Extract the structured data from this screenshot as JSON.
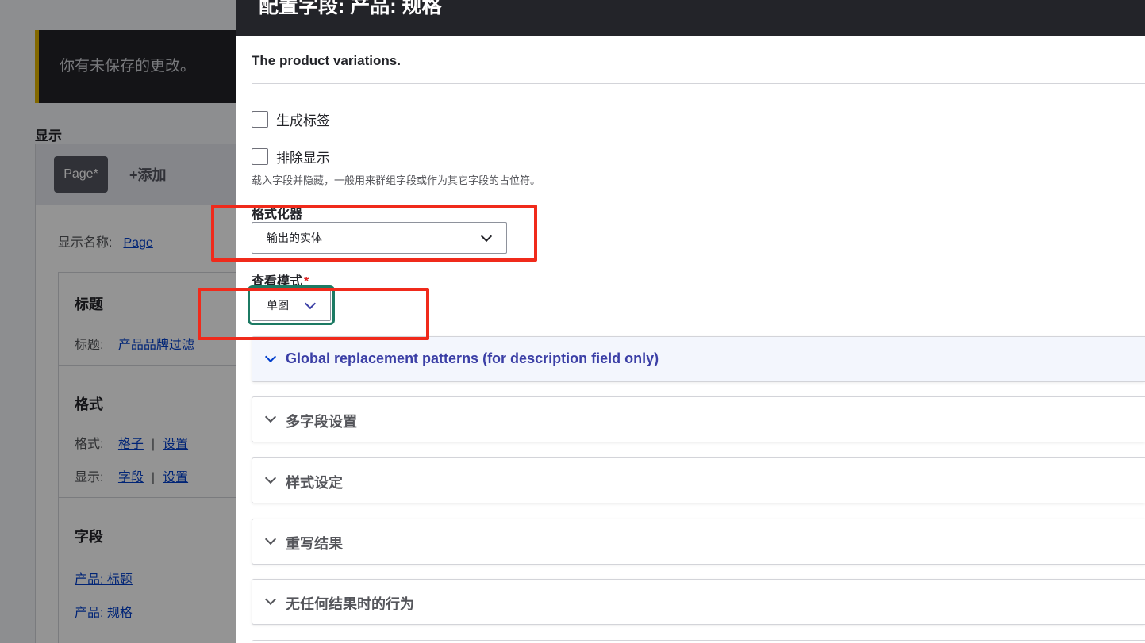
{
  "background": {
    "message": "你有未保存的更改。",
    "section_title": "显示",
    "tabs": {
      "active": "Page*",
      "add": "+添加"
    },
    "display_name_label": "显示名称:",
    "display_name_value": "Page",
    "title_section": {
      "heading": "标题",
      "label": "标题:",
      "value": "产品品牌过滤"
    },
    "format_section": {
      "heading": "格式",
      "format_label": "格式:",
      "format_value": "格子",
      "format_settings": "设置",
      "show_label": "显示:",
      "show_value": "字段",
      "show_settings": "设置"
    },
    "fields_section": {
      "heading": "字段",
      "items": [
        "产品: 标题",
        "产品: 规格"
      ]
    }
  },
  "dialog": {
    "title": "配置字段: 产品: 规格",
    "field_description": "The product variations.",
    "create_label": "生成标签",
    "exclude_label": "排除显示",
    "exclude_help": "载入字段并隐藏，一般用来群组字段或作为其它字段的占位符。",
    "formatter": {
      "label": "格式化器",
      "value": "输出的实体"
    },
    "view_mode": {
      "label": "查看模式",
      "required_mark": "*",
      "value": "单图"
    },
    "sections": [
      {
        "label": "Global replacement patterns (for description field only)",
        "open": true
      },
      {
        "label": "多字段设置",
        "open": false
      },
      {
        "label": "样式设定",
        "open": false
      },
      {
        "label": "重写结果",
        "open": false
      },
      {
        "label": "无任何结果时的行为",
        "open": false
      }
    ]
  },
  "colors": {
    "annotation": "#f02a1b",
    "focus_ring": "#1c7a63",
    "titlebar": "#232429",
    "link": "#003ecc"
  }
}
